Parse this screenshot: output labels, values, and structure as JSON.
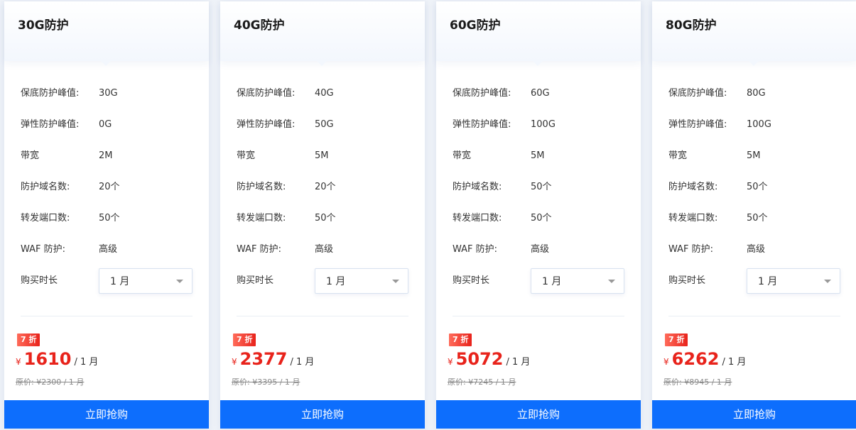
{
  "labels": {
    "base_protection": "保底防护峰值:",
    "elastic_protection": "弹性防护峰值:",
    "bandwidth": "带宽",
    "domains": "防护域名数:",
    "ports": "转发端口数:",
    "waf": "WAF 防护:",
    "duration": "购买时长",
    "buy_button": "立即抢购",
    "currency": "¥",
    "discount": "7 折"
  },
  "plans": [
    {
      "title": "30G防护",
      "base_protection": "30G",
      "elastic_protection": "0G",
      "bandwidth": "2M",
      "domains": "20个",
      "ports": "50个",
      "waf": "高级",
      "duration": "1 月",
      "price": "1610",
      "per_unit": "/ 1 月",
      "original_price": "原价: ¥2300 / 1 月"
    },
    {
      "title": "40G防护",
      "base_protection": "40G",
      "elastic_protection": "50G",
      "bandwidth": "5M",
      "domains": "20个",
      "ports": "50个",
      "waf": "高级",
      "duration": "1 月",
      "price": "2377",
      "per_unit": "/ 1 月",
      "original_price": "原价: ¥3395 / 1 月"
    },
    {
      "title": "60G防护",
      "base_protection": "60G",
      "elastic_protection": "100G",
      "bandwidth": "5M",
      "domains": "50个",
      "ports": "50个",
      "waf": "高级",
      "duration": "1 月",
      "price": "5072",
      "per_unit": "/ 1 月",
      "original_price": "原价: ¥7245 / 1 月"
    },
    {
      "title": "80G防护",
      "base_protection": "80G",
      "elastic_protection": "100G",
      "bandwidth": "5M",
      "domains": "50个",
      "ports": "50个",
      "waf": "高级",
      "duration": "1 月",
      "price": "6262",
      "per_unit": "/ 1 月",
      "original_price": "原价: ¥8945 / 1 月"
    }
  ],
  "colors": {
    "accent": "#0d6efd",
    "price": "#e8231b",
    "badge": "#e8231b"
  },
  "icons": {
    "select_caret": "chevron-down-icon"
  }
}
